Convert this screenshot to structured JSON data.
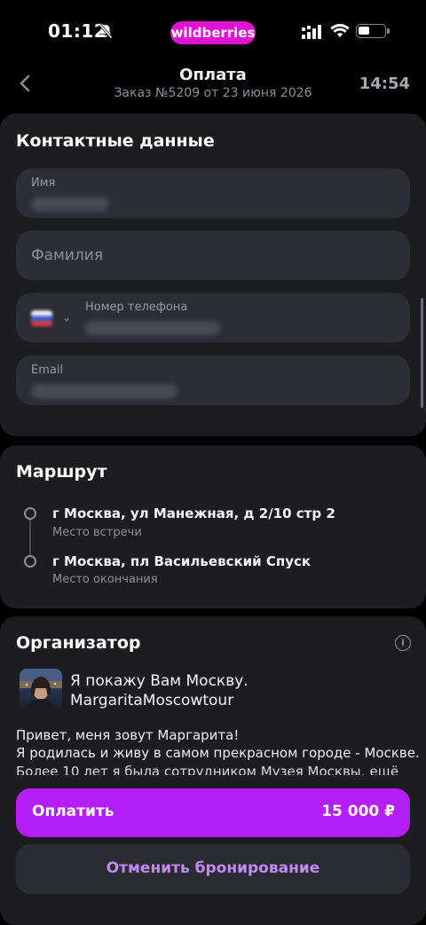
{
  "status_bar": {
    "time": "01:12",
    "brand": "wildberries",
    "brand_color": "#e112d2"
  },
  "header": {
    "title": "Оплата",
    "subtitle": "Заказ №5209 от 23 июня 2026",
    "timer": "14:54",
    "back_icon": "chevron-left-icon"
  },
  "contacts": {
    "title": "Контактные данные",
    "first_name": {
      "label": "Имя",
      "value": ""
    },
    "last_name": {
      "placeholder": "Фамилия"
    },
    "phone": {
      "label": "Номер телефона",
      "value": ""
    },
    "email": {
      "label": "Email",
      "value": ""
    }
  },
  "route": {
    "title": "Маршрут",
    "stops": [
      {
        "address": "г Москва, ул Манежная, д 2/10 стр 2",
        "note": "Место встречи"
      },
      {
        "address": "г Москва, пл Васильевский Спуск",
        "note": "Место окончания"
      }
    ]
  },
  "organizer": {
    "title": "Организатор",
    "name_line1": "Я покажу Вам Москву.",
    "name_line2": "MargaritaMoscowtour",
    "desc_line1": "Привет, меня зовут Маргарита!",
    "desc_line2": "Я родилась и живу в самом прекрасном городе - Москве.",
    "desc_line3": "Более 10 лет я была сотрудником Музея Москвы,",
    "more_link": "ещё"
  },
  "actions": {
    "pay_label": "Оплатить",
    "pay_amount": "15 000 ₽",
    "cancel_label": "Отменить бронирование",
    "accent_color": "#b41ef7"
  }
}
